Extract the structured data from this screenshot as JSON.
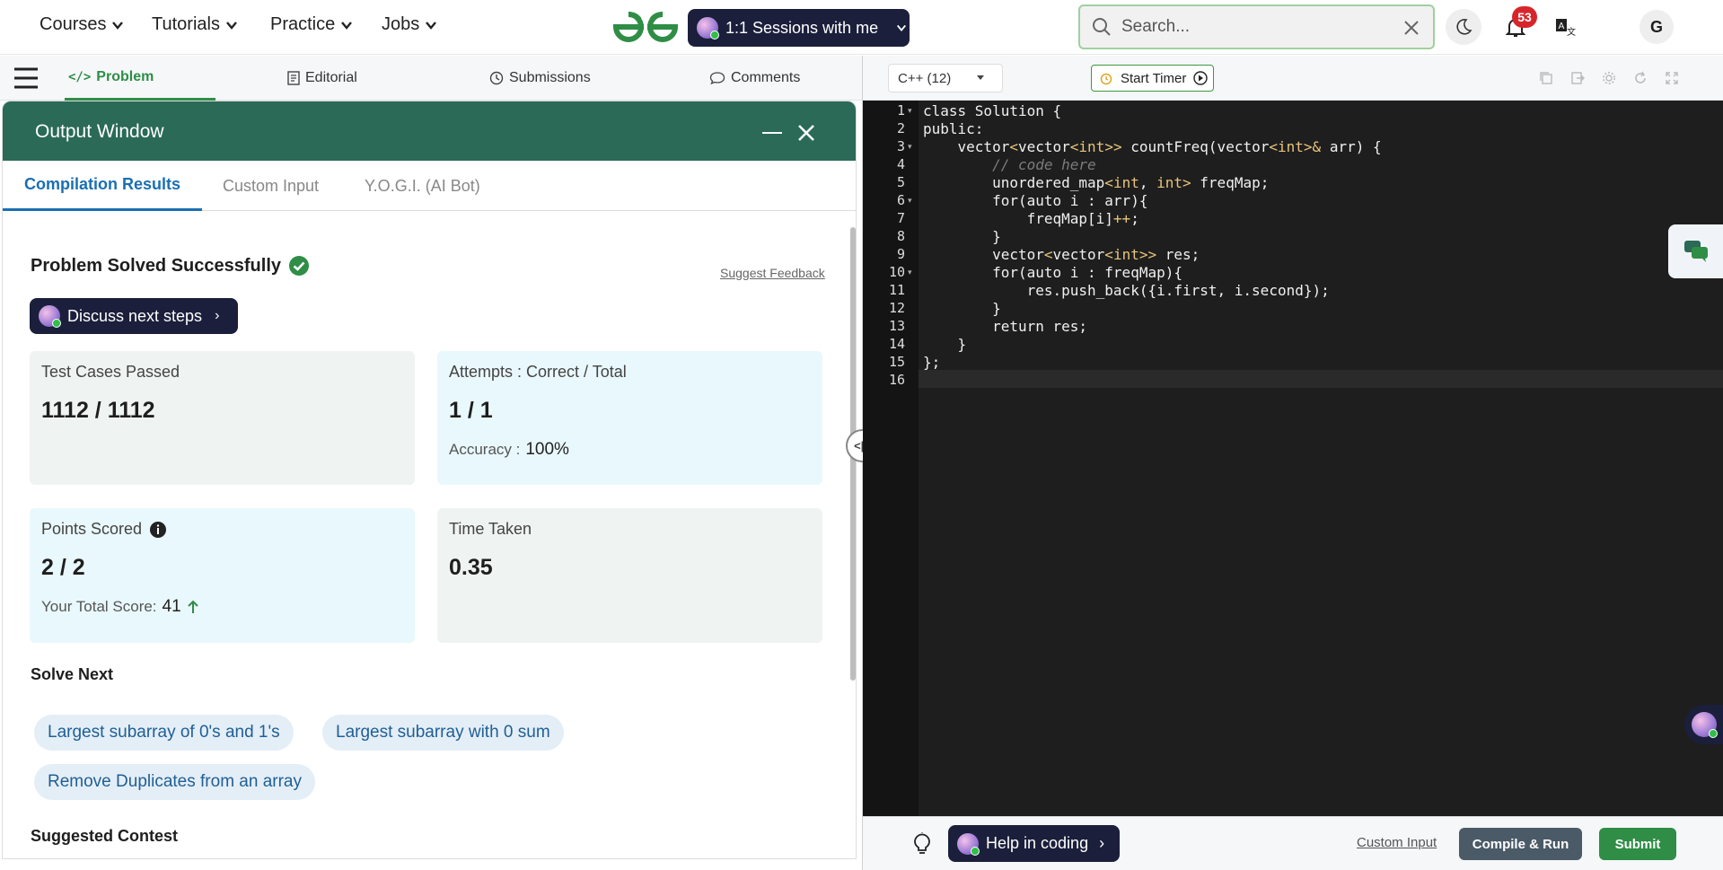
{
  "nav": {
    "items": [
      {
        "label": "Courses"
      },
      {
        "label": "Tutorials"
      },
      {
        "label": "Practice"
      },
      {
        "label": "Jobs"
      }
    ],
    "sessions_label": "1:1 Sessions with me",
    "search_placeholder": "Search...",
    "notifications_count": "53",
    "user_initial": "G"
  },
  "problem_tabs": [
    {
      "label": "Problem"
    },
    {
      "label": "Editorial"
    },
    {
      "label": "Submissions"
    },
    {
      "label": "Comments"
    }
  ],
  "output": {
    "title": "Output Window",
    "tabs": [
      {
        "label": "Compilation Results"
      },
      {
        "label": "Custom Input"
      },
      {
        "label": "Y.O.G.I. (AI Bot)"
      }
    ],
    "status": "Problem Solved Successfully",
    "feedback_link": "Suggest Feedback",
    "discuss_label": "Discuss next steps",
    "cards": {
      "tests": {
        "label": "Test Cases Passed",
        "value": "1112 / 1112"
      },
      "attempts": {
        "label": "Attempts : Correct / Total",
        "value": "1 / 1",
        "sub_label": "Accuracy :",
        "sub_value": "100%"
      },
      "points": {
        "label": "Points Scored",
        "value": "2 / 2",
        "sub_label": "Your Total Score:",
        "sub_value": "41"
      },
      "time": {
        "label": "Time Taken",
        "value": "0.35"
      }
    },
    "solve_next_title": "Solve Next",
    "solve_next": [
      {
        "label": "Largest subarray of 0's and 1's"
      },
      {
        "label": "Largest subarray with 0 sum"
      },
      {
        "label": "Remove Duplicates from an array"
      }
    ],
    "contest_title": "Suggested Contest"
  },
  "editor": {
    "language": "C++ (12)",
    "timer_label": "Start Timer",
    "lines": [
      "class Solution {",
      "public:",
      "    vector<vector<int>> countFreq(vector<int>& arr) {",
      "        // code here",
      "        unordered_map<int, int> freqMap;",
      "        for(auto i : arr){",
      "            freqMap[i]++;",
      "        }",
      "        vector<vector<int>> res;",
      "        for(auto i : freqMap){",
      "            res.push_back({i.first, i.second});",
      "        }",
      "        return res;",
      "    }",
      "};",
      ""
    ]
  },
  "footer": {
    "help_label": "Help in coding",
    "custom_input_link": "Custom Input",
    "compile_label": "Compile & Run",
    "submit_label": "Submit"
  },
  "colors": {
    "brand_green": "#2f8d46",
    "output_header": "#2a6a56",
    "link_blue": "#1a6fb4",
    "dark_button": "#1b1f3b",
    "editor_bg": "#1e1e1e"
  }
}
